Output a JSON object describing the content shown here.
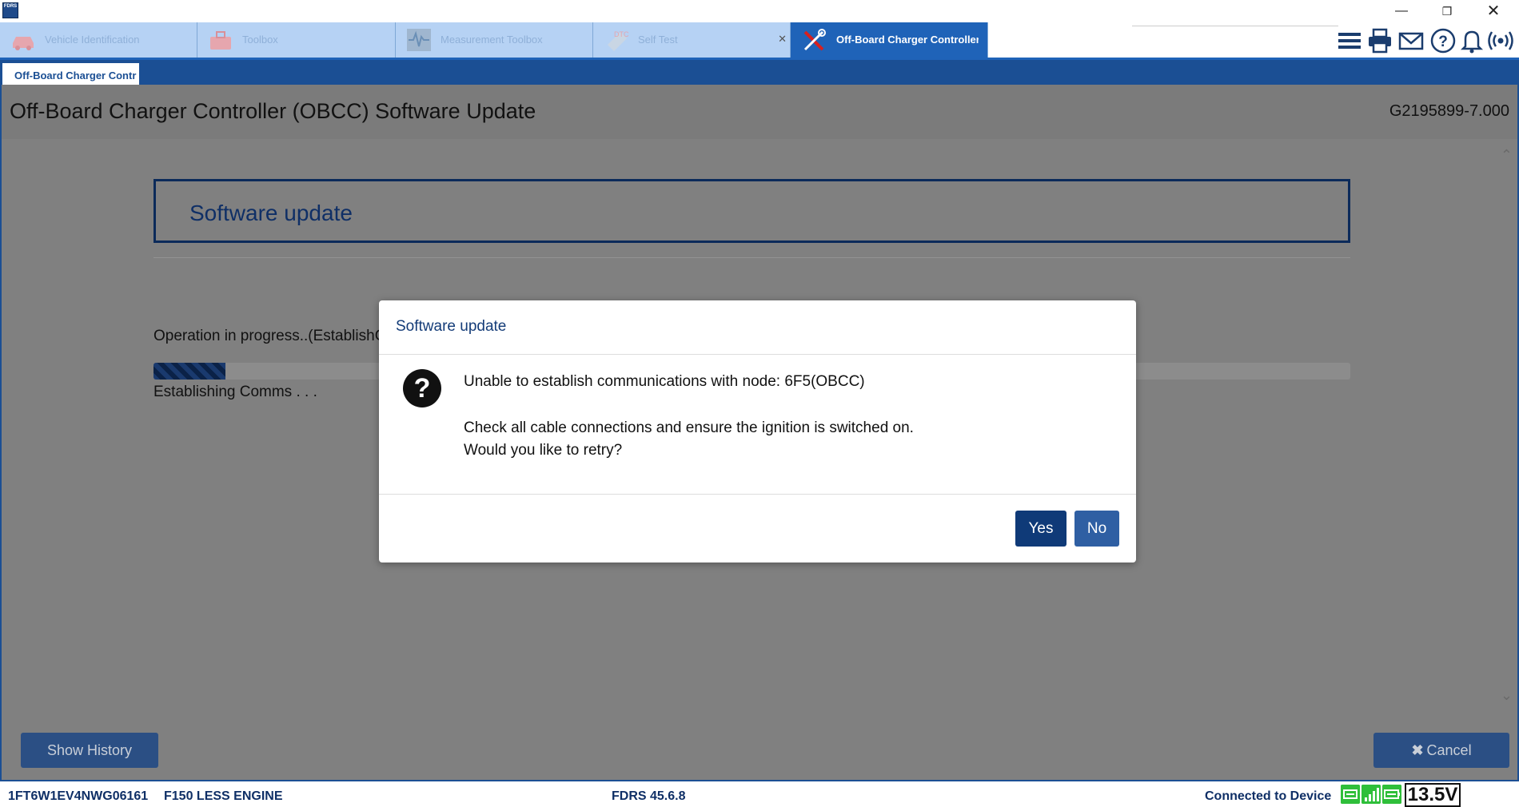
{
  "app": {
    "logo_text": "FDRS"
  },
  "window_controls": {
    "minimize": "—",
    "maximize": "❐",
    "close": "✕"
  },
  "module_tabs": [
    {
      "label": "Vehicle Identification",
      "icon": "car-icon"
    },
    {
      "label": "Toolbox",
      "icon": "toolbox-icon"
    },
    {
      "label": "Measurement Toolbox",
      "icon": "waveform-icon"
    },
    {
      "label": "Self Test",
      "icon": "dtc-icon",
      "close": "✕"
    },
    {
      "label": "Off-Board Charger Controller (O",
      "icon": "tools-icon",
      "active": true
    }
  ],
  "toolbar_icons": [
    "menu-icon",
    "printer-icon",
    "mail-icon",
    "help-icon",
    "bell-icon",
    "wireless-icon"
  ],
  "sub_tab": {
    "label": "Off-Board Charger Contr"
  },
  "page": {
    "title": "Off-Board Charger Controller (OBCC) Software Update",
    "part_number": "G2195899-7.000"
  },
  "section": {
    "title": "Software update"
  },
  "progress": {
    "operation_text": "Operation in progress..(EstablishC",
    "fraction": 0.06,
    "status_text": "Establishing Comms . . ."
  },
  "buttons": {
    "show_history": "Show History",
    "cancel_icon": "✖",
    "cancel": "Cancel"
  },
  "dialog": {
    "title": "Software update",
    "icon": "?",
    "message_line1": "Unable to establish communications with node: 6F5(OBCC)",
    "message_line2": "Check all cable connections and ensure the ignition is switched on.",
    "message_line3": "Would you like to retry?",
    "yes": "Yes",
    "no": "No"
  },
  "statusbar": {
    "vin": "1FT6W1EV4NWG06161",
    "vehicle": "F150 LESS ENGINE",
    "version": "FDRS 45.6.8",
    "connection": "Connected to Device",
    "voltage": "13.5V"
  },
  "colors": {
    "accent": "#1f63b8",
    "dark_blue": "#1b4f94",
    "status_green": "#2fbf3a"
  }
}
